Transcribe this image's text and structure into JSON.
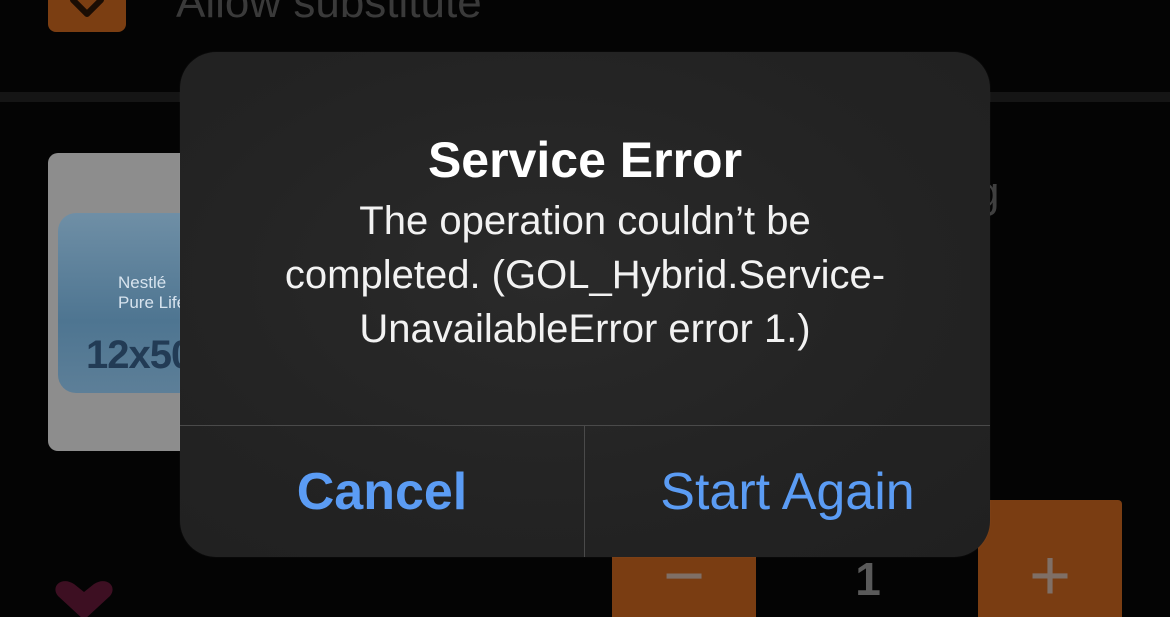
{
  "background": {
    "substitute_label": "Allow substitute",
    "product_brand": "Nestlé Pure Life",
    "product_pack": "12x50",
    "product_name_tail": "g",
    "quantity": "1",
    "accent_color": "#7a3d12"
  },
  "alert": {
    "title": "Service Error",
    "message_lines": [
      "The operation couldn’t be",
      "completed. (GOL_Hybrid.Service-",
      "UnavailableError error 1.)"
    ],
    "cancel_label": "Cancel",
    "start_again_label": "Start Again",
    "button_color": "#5b9cf4"
  }
}
